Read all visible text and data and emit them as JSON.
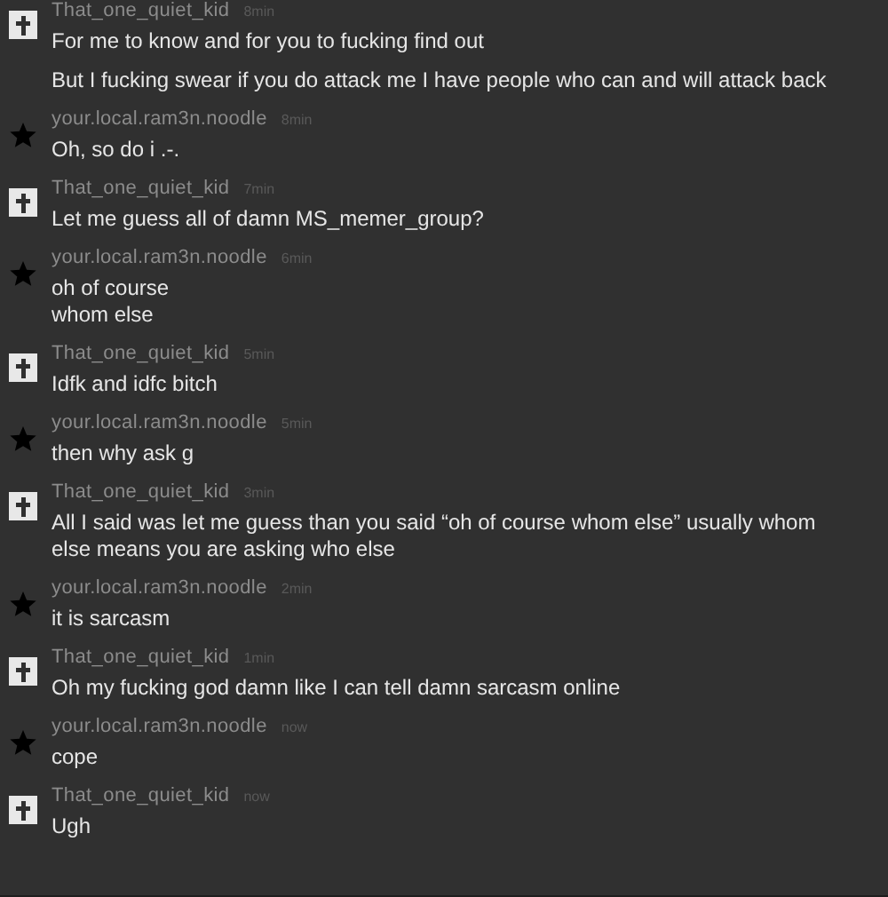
{
  "messages": [
    {
      "author": "That_one_quiet_kid",
      "time": "8min",
      "kind": "cross",
      "paragraphs": [
        "For me to know and for you to fucking find out",
        "But I fucking swear if you do attack me I have people who can and will attack back"
      ]
    },
    {
      "author": "your.local.ram3n.noodle",
      "time": "8min",
      "kind": "star",
      "paragraphs": [
        "Oh, so do i .-."
      ]
    },
    {
      "author": "That_one_quiet_kid",
      "time": "7min",
      "kind": "cross",
      "paragraphs": [
        "Let me guess all of damn MS_memer_group?"
      ]
    },
    {
      "author": "your.local.ram3n.noodle",
      "time": "6min",
      "kind": "star",
      "paragraphs": [
        "oh of course\nwhom else"
      ]
    },
    {
      "author": "That_one_quiet_kid",
      "time": "5min",
      "kind": "cross",
      "paragraphs": [
        "Idfk and idfc bitch"
      ]
    },
    {
      "author": "your.local.ram3n.noodle",
      "time": "5min",
      "kind": "star",
      "paragraphs": [
        "then why ask g"
      ]
    },
    {
      "author": "That_one_quiet_kid",
      "time": "3min",
      "kind": "cross",
      "paragraphs": [
        "All I said was let me guess than you said “oh of course whom else” usually whom else means you are asking who else"
      ]
    },
    {
      "author": "your.local.ram3n.noodle",
      "time": "2min",
      "kind": "star",
      "paragraphs": [
        "it is sarcasm"
      ]
    },
    {
      "author": "That_one_quiet_kid",
      "time": "1min",
      "kind": "cross",
      "paragraphs": [
        "Oh my fucking god damn like I can tell damn sarcasm online"
      ]
    },
    {
      "author": "your.local.ram3n.noodle",
      "time": "now",
      "kind": "star",
      "paragraphs": [
        "cope"
      ]
    },
    {
      "author": "That_one_quiet_kid",
      "time": "now",
      "kind": "cross",
      "paragraphs": [
        "Ugh"
      ]
    }
  ]
}
